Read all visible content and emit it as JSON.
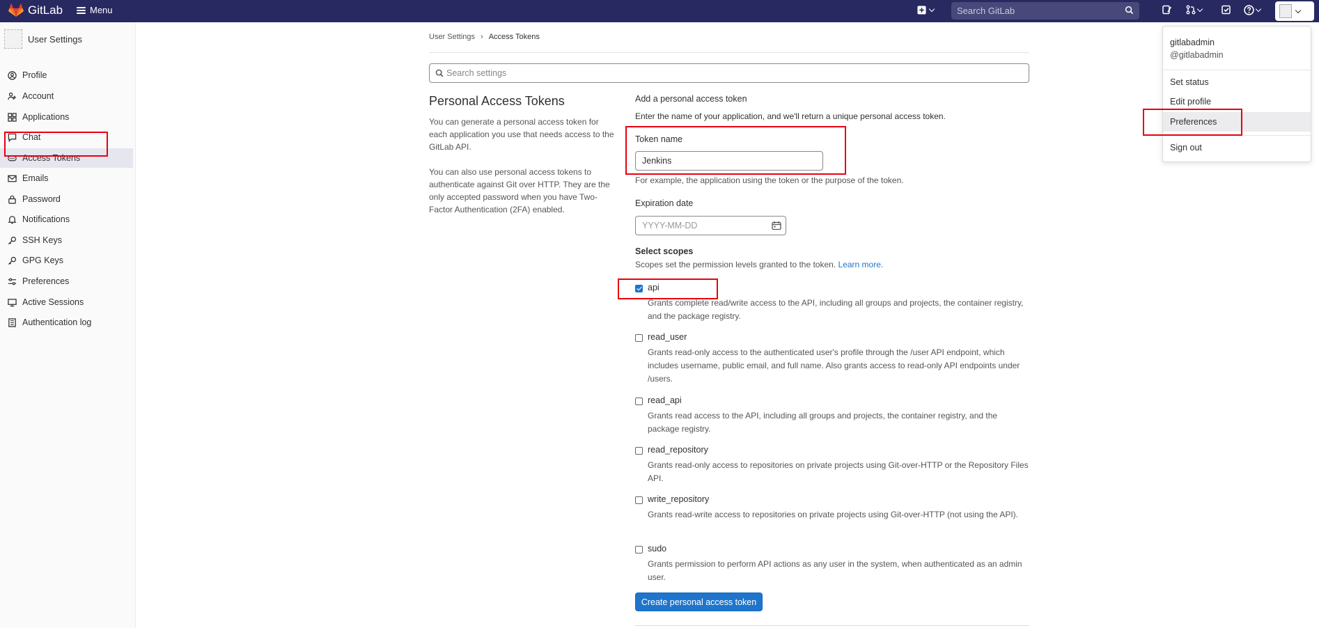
{
  "topbar": {
    "app_name": "GitLab",
    "menu_label": "Menu",
    "search_placeholder": "Search GitLab",
    "avatar_alt": "gitlabad"
  },
  "sidebar": {
    "title": "User Settings",
    "avatar_alt": "gitla",
    "items": [
      {
        "label": "Profile",
        "icon": "profile-icon"
      },
      {
        "label": "Account",
        "icon": "account-icon"
      },
      {
        "label": "Applications",
        "icon": "applications-icon"
      },
      {
        "label": "Chat",
        "icon": "chat-icon"
      },
      {
        "label": "Access Tokens",
        "icon": "token-icon",
        "active": true
      },
      {
        "label": "Emails",
        "icon": "mail-icon"
      },
      {
        "label": "Password",
        "icon": "lock-icon"
      },
      {
        "label": "Notifications",
        "icon": "bell-icon"
      },
      {
        "label": "SSH Keys",
        "icon": "key-icon"
      },
      {
        "label": "GPG Keys",
        "icon": "key-icon"
      },
      {
        "label": "Preferences",
        "icon": "preferences-icon"
      },
      {
        "label": "Active Sessions",
        "icon": "monitor-icon"
      },
      {
        "label": "Authentication log",
        "icon": "log-icon"
      }
    ]
  },
  "breadcrumb": {
    "parent": "User Settings",
    "current": "Access Tokens"
  },
  "settings_search": {
    "placeholder": "Search settings"
  },
  "left_panel": {
    "title": "Personal Access Tokens",
    "para1": "You can generate a personal access token for each application you use that needs access to the GitLab API.",
    "para2": "You can also use personal access tokens to authenticate against Git over HTTP. They are the only accepted password when you have Two-Factor Authentication (2FA) enabled."
  },
  "form": {
    "heading": "Add a personal access token",
    "intro": "Enter the name of your application, and we'll return a unique personal access token.",
    "token_name_label": "Token name",
    "token_name_value": "Jenkins",
    "token_name_help": "For example, the application using the token or the purpose of the token.",
    "expiration_label": "Expiration date",
    "expiration_placeholder": "YYYY-MM-DD",
    "scopes_label": "Select scopes",
    "scopes_help": "Scopes set the permission levels granted to the token.",
    "scopes_link": "Learn more.",
    "scopes": [
      {
        "name": "api",
        "checked": true,
        "desc": "Grants complete read/write access to the API, including all groups and projects, the container registry, and the package registry."
      },
      {
        "name": "read_user",
        "checked": false,
        "desc": "Grants read-only access to the authenticated user's profile through the /user API endpoint, which includes username, public email, and full name. Also grants access to read-only API endpoints under /users."
      },
      {
        "name": "read_api",
        "checked": false,
        "desc": "Grants read access to the API, including all groups and projects, the container registry, and the package registry."
      },
      {
        "name": "read_repository",
        "checked": false,
        "desc": "Grants read-only access to repositories on private projects using Git-over-HTTP or the Repository Files API."
      },
      {
        "name": "write_repository",
        "checked": false,
        "desc": "Grants read-write access to repositories on private projects using Git-over-HTTP (not using the API)."
      },
      {
        "name": "sudo",
        "checked": false,
        "desc": "Grants permission to perform API actions as any user in the system, when authenticated as an admin user."
      }
    ],
    "submit_label": "Create personal access token"
  },
  "user_dropdown": {
    "name": "gitlabadmin",
    "username": "@gitlabadmin",
    "items": [
      "Set status",
      "Edit profile",
      "Preferences",
      "Sign out"
    ]
  },
  "colors": {
    "nav_bg": "#292961",
    "primary": "#1f75cb",
    "highlight": "#e8000e"
  }
}
